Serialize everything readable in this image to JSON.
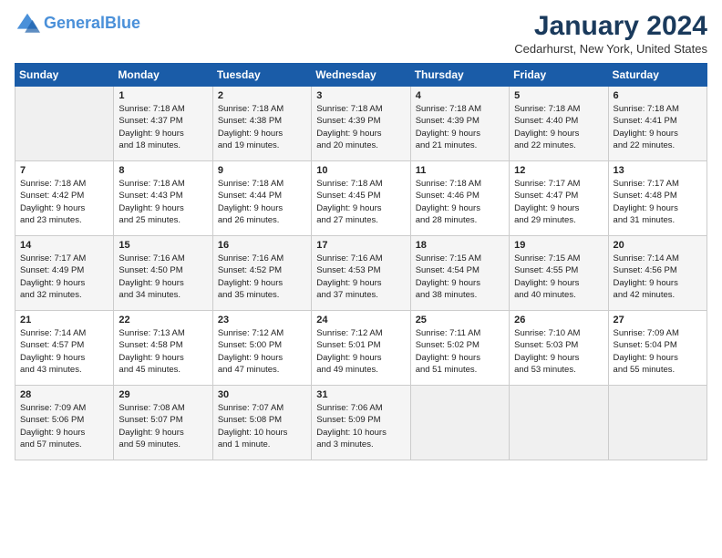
{
  "header": {
    "logo_line1": "General",
    "logo_line2": "Blue",
    "title": "January 2024",
    "location": "Cedarhurst, New York, United States"
  },
  "days_of_week": [
    "Sunday",
    "Monday",
    "Tuesday",
    "Wednesday",
    "Thursday",
    "Friday",
    "Saturday"
  ],
  "weeks": [
    [
      {
        "day": "",
        "content": ""
      },
      {
        "day": "1",
        "content": "Sunrise: 7:18 AM\nSunset: 4:37 PM\nDaylight: 9 hours\nand 18 minutes."
      },
      {
        "day": "2",
        "content": "Sunrise: 7:18 AM\nSunset: 4:38 PM\nDaylight: 9 hours\nand 19 minutes."
      },
      {
        "day": "3",
        "content": "Sunrise: 7:18 AM\nSunset: 4:39 PM\nDaylight: 9 hours\nand 20 minutes."
      },
      {
        "day": "4",
        "content": "Sunrise: 7:18 AM\nSunset: 4:39 PM\nDaylight: 9 hours\nand 21 minutes."
      },
      {
        "day": "5",
        "content": "Sunrise: 7:18 AM\nSunset: 4:40 PM\nDaylight: 9 hours\nand 22 minutes."
      },
      {
        "day": "6",
        "content": "Sunrise: 7:18 AM\nSunset: 4:41 PM\nDaylight: 9 hours\nand 22 minutes."
      }
    ],
    [
      {
        "day": "7",
        "content": "Sunrise: 7:18 AM\nSunset: 4:42 PM\nDaylight: 9 hours\nand 23 minutes."
      },
      {
        "day": "8",
        "content": "Sunrise: 7:18 AM\nSunset: 4:43 PM\nDaylight: 9 hours\nand 25 minutes."
      },
      {
        "day": "9",
        "content": "Sunrise: 7:18 AM\nSunset: 4:44 PM\nDaylight: 9 hours\nand 26 minutes."
      },
      {
        "day": "10",
        "content": "Sunrise: 7:18 AM\nSunset: 4:45 PM\nDaylight: 9 hours\nand 27 minutes."
      },
      {
        "day": "11",
        "content": "Sunrise: 7:18 AM\nSunset: 4:46 PM\nDaylight: 9 hours\nand 28 minutes."
      },
      {
        "day": "12",
        "content": "Sunrise: 7:17 AM\nSunset: 4:47 PM\nDaylight: 9 hours\nand 29 minutes."
      },
      {
        "day": "13",
        "content": "Sunrise: 7:17 AM\nSunset: 4:48 PM\nDaylight: 9 hours\nand 31 minutes."
      }
    ],
    [
      {
        "day": "14",
        "content": "Sunrise: 7:17 AM\nSunset: 4:49 PM\nDaylight: 9 hours\nand 32 minutes."
      },
      {
        "day": "15",
        "content": "Sunrise: 7:16 AM\nSunset: 4:50 PM\nDaylight: 9 hours\nand 34 minutes."
      },
      {
        "day": "16",
        "content": "Sunrise: 7:16 AM\nSunset: 4:52 PM\nDaylight: 9 hours\nand 35 minutes."
      },
      {
        "day": "17",
        "content": "Sunrise: 7:16 AM\nSunset: 4:53 PM\nDaylight: 9 hours\nand 37 minutes."
      },
      {
        "day": "18",
        "content": "Sunrise: 7:15 AM\nSunset: 4:54 PM\nDaylight: 9 hours\nand 38 minutes."
      },
      {
        "day": "19",
        "content": "Sunrise: 7:15 AM\nSunset: 4:55 PM\nDaylight: 9 hours\nand 40 minutes."
      },
      {
        "day": "20",
        "content": "Sunrise: 7:14 AM\nSunset: 4:56 PM\nDaylight: 9 hours\nand 42 minutes."
      }
    ],
    [
      {
        "day": "21",
        "content": "Sunrise: 7:14 AM\nSunset: 4:57 PM\nDaylight: 9 hours\nand 43 minutes."
      },
      {
        "day": "22",
        "content": "Sunrise: 7:13 AM\nSunset: 4:58 PM\nDaylight: 9 hours\nand 45 minutes."
      },
      {
        "day": "23",
        "content": "Sunrise: 7:12 AM\nSunset: 5:00 PM\nDaylight: 9 hours\nand 47 minutes."
      },
      {
        "day": "24",
        "content": "Sunrise: 7:12 AM\nSunset: 5:01 PM\nDaylight: 9 hours\nand 49 minutes."
      },
      {
        "day": "25",
        "content": "Sunrise: 7:11 AM\nSunset: 5:02 PM\nDaylight: 9 hours\nand 51 minutes."
      },
      {
        "day": "26",
        "content": "Sunrise: 7:10 AM\nSunset: 5:03 PM\nDaylight: 9 hours\nand 53 minutes."
      },
      {
        "day": "27",
        "content": "Sunrise: 7:09 AM\nSunset: 5:04 PM\nDaylight: 9 hours\nand 55 minutes."
      }
    ],
    [
      {
        "day": "28",
        "content": "Sunrise: 7:09 AM\nSunset: 5:06 PM\nDaylight: 9 hours\nand 57 minutes."
      },
      {
        "day": "29",
        "content": "Sunrise: 7:08 AM\nSunset: 5:07 PM\nDaylight: 9 hours\nand 59 minutes."
      },
      {
        "day": "30",
        "content": "Sunrise: 7:07 AM\nSunset: 5:08 PM\nDaylight: 10 hours\nand 1 minute."
      },
      {
        "day": "31",
        "content": "Sunrise: 7:06 AM\nSunset: 5:09 PM\nDaylight: 10 hours\nand 3 minutes."
      },
      {
        "day": "",
        "content": ""
      },
      {
        "day": "",
        "content": ""
      },
      {
        "day": "",
        "content": ""
      }
    ]
  ]
}
